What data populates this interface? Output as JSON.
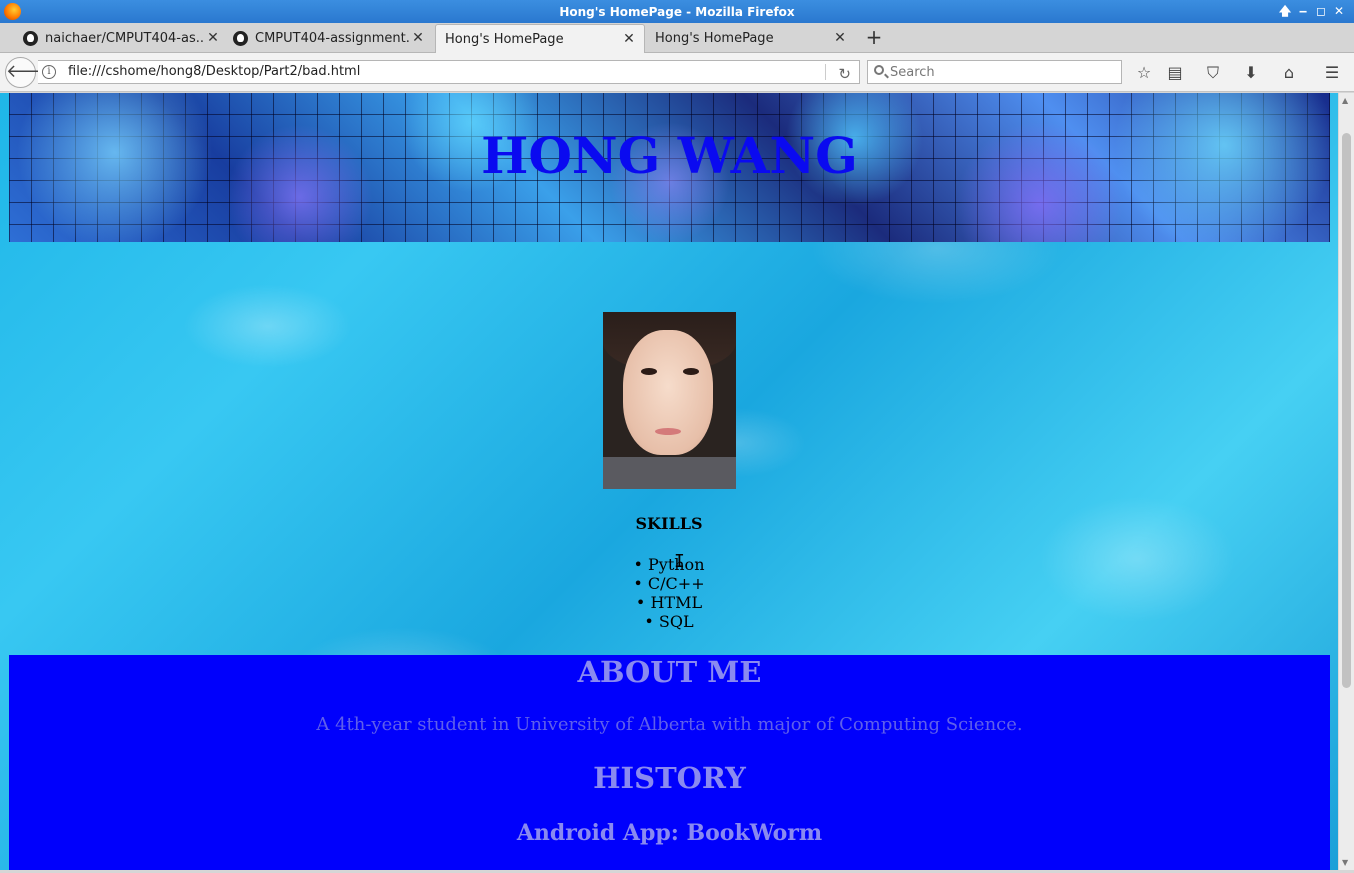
{
  "window": {
    "title": "Hong's HomePage - Mozilla Firefox"
  },
  "tabs": [
    {
      "label": "naichaer/CMPUT404-as...",
      "icon": "github-icon"
    },
    {
      "label": "CMPUT404-assignment...",
      "icon": "github-icon"
    },
    {
      "label": "Hong's HomePage",
      "icon": "none"
    },
    {
      "label": "Hong's HomePage",
      "icon": "none"
    }
  ],
  "navbar": {
    "url": "file:///cshome/hong8/Desktop/Part2/bad.html",
    "search_placeholder": "Search"
  },
  "page": {
    "title": "HONG WANG",
    "skills_heading": "SKILLS",
    "skills": [
      "Python",
      "C/C++",
      "HTML",
      "SQL"
    ],
    "about_heading": "ABOUT ME",
    "about_text": "A 4th-year student in University of Alberta with major of Computing Science.",
    "history_heading": "HISTORY",
    "project_title": "Android App: BookWorm"
  },
  "colors": {
    "title_color": "#0a0af0",
    "about_bg": "#0000fc",
    "about_heading_color": "#8a8af0",
    "about_text_color": "#5f5fea",
    "titlebar": "#2a78cf"
  }
}
